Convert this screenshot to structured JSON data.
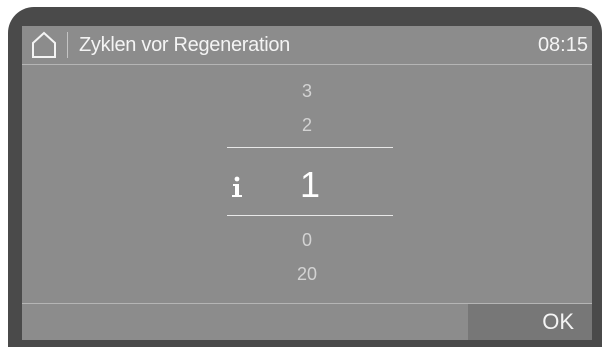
{
  "header": {
    "home_icon": "home-icon",
    "title": "Zyklen vor Regeneration",
    "clock": "08:15"
  },
  "wheel": {
    "above": [
      "3",
      "2"
    ],
    "selected": "1",
    "below": [
      "0",
      "20"
    ],
    "info_icon": "info-icon"
  },
  "footer": {
    "ok_label": "OK"
  },
  "colors": {
    "bezel": "#4a4a4a",
    "screen": "#8c8c8c",
    "text": "#f4f4f4",
    "dim_text": "#d3d3d3",
    "button": "#777777"
  }
}
